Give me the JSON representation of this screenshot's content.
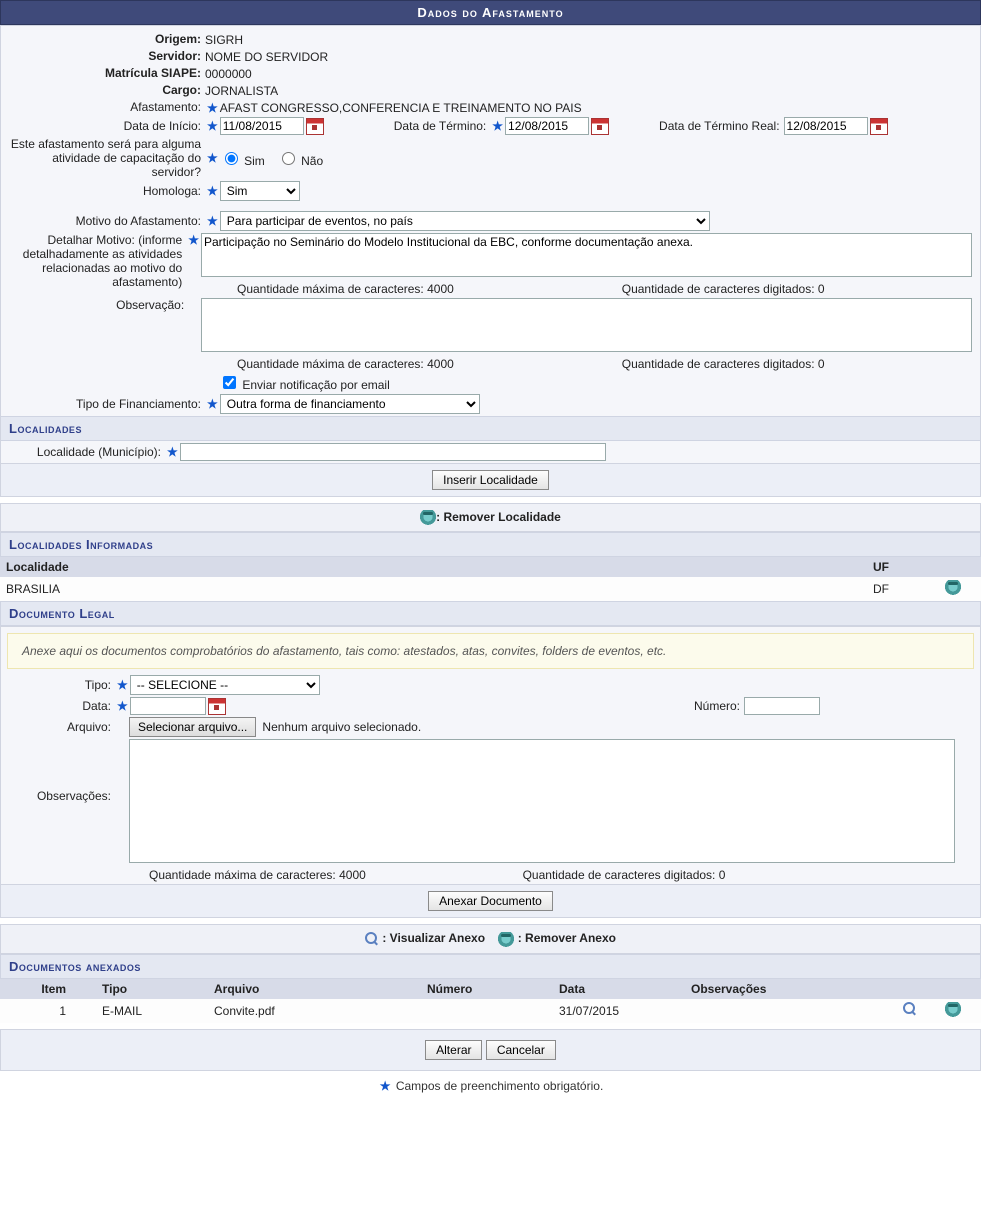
{
  "header": {
    "title": "Dados do Afastamento"
  },
  "fields": {
    "origem_label": "Origem:",
    "origem_value": "SIGRH",
    "servidor_label": "Servidor:",
    "servidor_value": "NOME DO SERVIDOR",
    "matricula_label": "Matrícula SIAPE:",
    "matricula_value": "0000000",
    "cargo_label": "Cargo:",
    "cargo_value": "JORNALISTA",
    "afastamento_label": "Afastamento:",
    "afastamento_value": "AFAST CONGRESSO,CONFERENCIA E TREINAMENTO NO PAIS",
    "data_inicio_label": "Data de Início:",
    "data_inicio_value": "11/08/2015",
    "data_termino_label": "Data de Término:",
    "data_termino_value": "12/08/2015",
    "data_termino_real_label": "Data de Término Real:",
    "data_termino_real_value": "12/08/2015",
    "capacitacao_label": "Este afastamento será para alguma atividade de capacitação do servidor?",
    "radio_sim": "Sim",
    "radio_nao": "Não",
    "homologa_label": "Homologa:",
    "homologa_value": "Sim",
    "motivo_label": "Motivo do Afastamento:",
    "motivo_value": "Para participar de eventos, no país",
    "detalhar_label": "Detalhar Motivo: (informe detalhadamente as atividades relacionadas ao motivo do afastamento)",
    "detalhar_value": "Participação no Seminário do Modelo Institucional da EBC, conforme documentação anexa.",
    "obs_label": "Observação:",
    "obs_value": "",
    "max_chars_label": "Quantidade máxima de caracteres: 4000",
    "typed_chars_label": "Quantidade de caracteres digitados: 0",
    "notify_label": "Enviar notificação por email",
    "fin_label": "Tipo de Financiamento:",
    "fin_value": "Outra forma de financiamento"
  },
  "localidades": {
    "section": "Localidades",
    "loc_label": "Localidade (Município):",
    "loc_value": "",
    "inserir_btn": "Inserir Localidade",
    "remover_legend": ": Remover Localidade",
    "informadas_section": "Localidades Informadas",
    "col_localidade": "Localidade",
    "col_uf": "UF",
    "rows": [
      {
        "localidade": "BRASILIA",
        "uf": "DF"
      }
    ]
  },
  "documento": {
    "section": "Documento Legal",
    "info": "Anexe aqui os documentos comprobatórios do afastamento, tais como: atestados, atas, convites, folders de eventos, etc.",
    "tipo_label": "Tipo:",
    "tipo_value": "-- SELECIONE --",
    "data_label": "Data:",
    "data_value": "",
    "numero_label": "Número:",
    "numero_value": "",
    "arquivo_label": "Arquivo:",
    "arquivo_btn": "Selecionar arquivo...",
    "arquivo_status": "Nenhum arquivo selecionado.",
    "obs_label": "Observações:",
    "obs_value": "",
    "anexar_btn": "Anexar Documento",
    "visualizar_legend": " : Visualizar Anexo",
    "remover_legend": " : Remover Anexo",
    "anexados_section": "Documentos anexados",
    "cols": {
      "item": "Item",
      "tipo": "Tipo",
      "arquivo": "Arquivo",
      "numero": "Número",
      "data": "Data",
      "obs": "Observações"
    },
    "rows": [
      {
        "item": "1",
        "tipo": "E-MAIL",
        "arquivo": "Convite.pdf",
        "numero": "",
        "data": "31/07/2015",
        "obs": ""
      }
    ]
  },
  "actions": {
    "alterar": "Alterar",
    "cancelar": "Cancelar"
  },
  "footnote": "Campos de preenchimento obrigatório."
}
